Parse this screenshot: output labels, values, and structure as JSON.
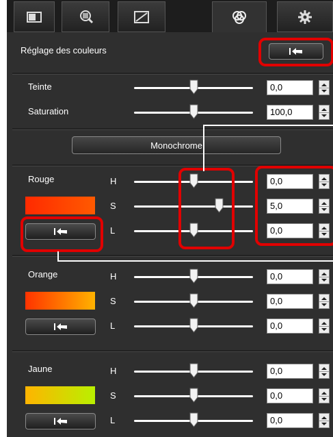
{
  "tabs": [
    {
      "icon": "basic-adjust-icon"
    },
    {
      "icon": "zoom-detail-icon"
    },
    {
      "icon": "tone-curve-icon"
    },
    {
      "icon": "color-adjust-icon",
      "active": true
    },
    {
      "icon": "settings-gear-icon"
    }
  ],
  "panel": {
    "title": "Réglage des couleurs"
  },
  "global": [
    {
      "label": "Teinte",
      "value": "0,0",
      "level": 0.5
    },
    {
      "label": "Saturation",
      "value": "100,0",
      "level": 0.5
    }
  ],
  "monochrome_label": "Monochrome",
  "hsl_labels": [
    "H",
    "S",
    "L"
  ],
  "colors": [
    {
      "name": "Rouge",
      "swatch": [
        "#ff2a00",
        "#ff5a00"
      ],
      "values": [
        "0,0",
        "5,0",
        "0,0"
      ],
      "levels": [
        0.5,
        0.71,
        0.5
      ]
    },
    {
      "name": "Orange",
      "swatch": [
        "#ff3300",
        "#ffb200"
      ],
      "values": [
        "0,0",
        "0,0",
        "0,0"
      ],
      "levels": [
        0.5,
        0.5,
        0.5
      ]
    },
    {
      "name": "Jaune",
      "swatch": [
        "#ffb400",
        "#b9f000"
      ],
      "values": [
        "0,0",
        "0,0",
        "0,0"
      ],
      "levels": [
        0.5,
        0.5,
        0.5
      ]
    }
  ],
  "accent_color": "#e10000"
}
